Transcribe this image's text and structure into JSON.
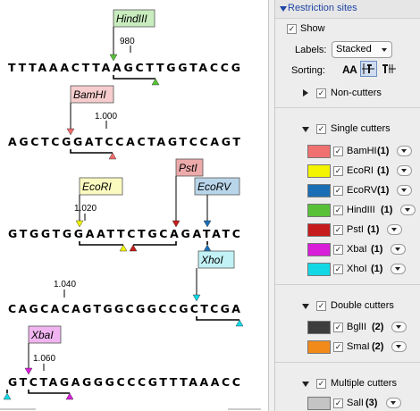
{
  "sequence_view": {
    "rows": [
      {
        "sequence": "TTTAAACTTAAGCTTGGTACCG",
        "ruler": "980"
      },
      {
        "sequence": "AGCTCGGATCCACTAGTCCAGT",
        "ruler": "1.000"
      },
      {
        "sequence": "GTGGTGGAATTCTGCAGATATC",
        "ruler": "1.020"
      },
      {
        "sequence": "CAGCACAGTGGCGGCCGCTCGA",
        "ruler": "1.040"
      },
      {
        "sequence": "GTCTAGAGGGCCCGTTTAAACC",
        "ruler": "1.060"
      }
    ],
    "enzymes": [
      {
        "name": "HindIII",
        "color": "#58c138"
      },
      {
        "name": "BamHI",
        "color": "#ef6b6b"
      },
      {
        "name": "EcoRI",
        "color": "#f2f200"
      },
      {
        "name": "PstI",
        "color": "#c71c1c"
      },
      {
        "name": "EcoRV",
        "color": "#1a6eb5"
      },
      {
        "name": "XhoI",
        "color": "#12d8e6"
      },
      {
        "name": "XbaI",
        "color": "#d81ed8"
      }
    ]
  },
  "panel": {
    "section_title": "Restriction sites",
    "show_label": "Show",
    "labels_label": "Labels:",
    "labels_value": "Stacked",
    "sorting_label": "Sorting:",
    "sort_icon_alpha": "AA",
    "non_cutters_label": "Non-cutters",
    "single_cutters_label": "Single cutters",
    "single_cutters": [
      {
        "name": "BamHI",
        "count": "(1)",
        "color": "#f07070",
        "checked": true
      },
      {
        "name": "EcoRI",
        "count": "(1)",
        "color": "#f4f400",
        "checked": true
      },
      {
        "name": "EcoRV",
        "count": "(1)",
        "color": "#1a6eb5",
        "checked": true
      },
      {
        "name": "HindIII",
        "count": "(1)",
        "color": "#58c138",
        "checked": true
      },
      {
        "name": "PstI",
        "count": "(1)",
        "color": "#c71c1c",
        "checked": true
      },
      {
        "name": "XbaI",
        "count": "(1)",
        "color": "#d81ed8",
        "checked": true
      },
      {
        "name": "XhoI",
        "count": "(1)",
        "color": "#12d8e6",
        "checked": true
      }
    ],
    "double_cutters_label": "Double cutters",
    "double_cutters": [
      {
        "name": "BglII",
        "count": "(2)",
        "color": "#3d3d3d",
        "checked": true
      },
      {
        "name": "SmaI",
        "count": "(2)",
        "color": "#f28a1a",
        "checked": true
      }
    ],
    "multiple_cutters_label": "Multiple cutters",
    "multiple_cutters": [
      {
        "name": "SalI",
        "count": "(3)",
        "color": "#c4c4c4",
        "checked": true
      }
    ]
  }
}
